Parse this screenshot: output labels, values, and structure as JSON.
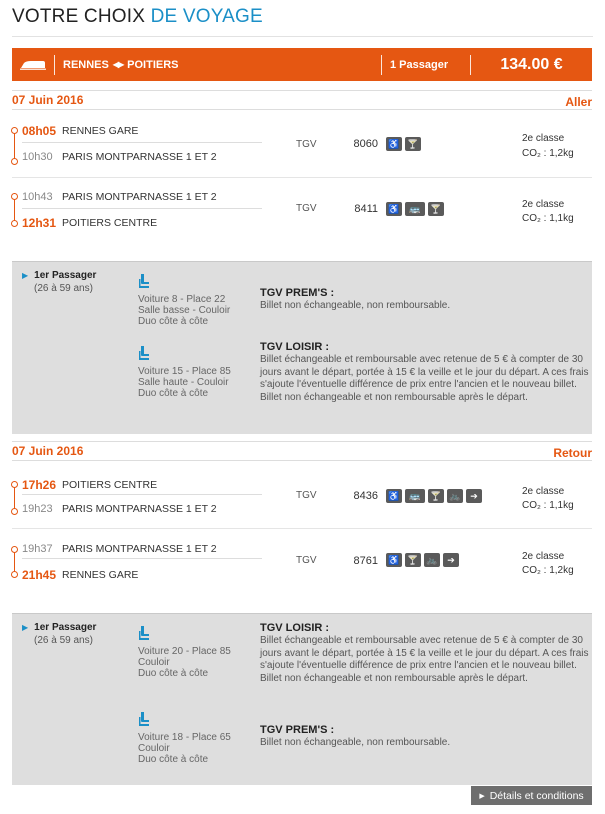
{
  "page": {
    "title_part1": "VOTRE CHOIX",
    "title_part2": "DE VOYAGE"
  },
  "summary": {
    "origin": "RENNES",
    "destination": "POITIERS",
    "passengers": "1 Passager",
    "price": "134.00 €"
  },
  "outbound": {
    "date": "07 Juin 2016",
    "direction": "Aller",
    "segments": [
      {
        "dep_time": "08h05",
        "dep_station": "RENNES GARE",
        "arr_time": "10h30",
        "arr_station": "PARIS MONTPARNASSE 1 ET 2",
        "type": "TGV",
        "number": "8060",
        "class": "2e classe",
        "co2": "CO₂ : 1,2kg",
        "icons": [
          "wheelchair-icon",
          "bar-icon"
        ]
      },
      {
        "dep_time": "10h43",
        "dep_station": "PARIS MONTPARNASSE 1 ET 2",
        "arr_time": "12h31",
        "arr_station": "POITIERS CENTRE",
        "type": "TGV",
        "number": "8411",
        "class": "2e classe",
        "co2": "CO₂ : 1,1kg",
        "icons": [
          "wheelchair-icon",
          "bus-icon",
          "bar-icon"
        ]
      }
    ],
    "passenger": {
      "label": "1er Passager",
      "age": "(26 à 59 ans)",
      "seats": [
        {
          "line1": "Voiture 8 - Place 22",
          "line2": "Salle basse - Couloir",
          "line3": "Duo côte à côte"
        },
        {
          "line1": "Voiture 15 - Place 85",
          "line2": "Salle haute - Couloir",
          "line3": "Duo côte à côte"
        }
      ],
      "tarifs": [
        {
          "name": "TGV PREM'S :",
          "desc": "Billet non échangeable, non remboursable."
        },
        {
          "name": "TGV LOISIR :",
          "desc": "Billet échangeable et remboursable avec retenue de 5 € à compter de 30 jours avant le départ, portée à 15 € la veille et le jour du départ. A ces frais s'ajoute l'éventuelle différence de prix entre l'ancien et le nouveau billet. Billet non échangeable et non remboursable après le départ."
        }
      ]
    }
  },
  "inbound": {
    "date": "07 Juin 2016",
    "direction": "Retour",
    "segments": [
      {
        "dep_time": "17h26",
        "dep_station": "POITIERS CENTRE",
        "arr_time": "19h23",
        "arr_station": "PARIS MONTPARNASSE 1 ET 2",
        "type": "TGV",
        "number": "8436",
        "class": "2e classe",
        "co2": "CO₂ : 1,1kg",
        "icons": [
          "wheelchair-icon",
          "bus-icon",
          "bar-icon",
          "bike-icon",
          "arrow-icon"
        ]
      },
      {
        "dep_time": "19h37",
        "dep_station": "PARIS MONTPARNASSE 1 ET 2",
        "arr_time": "21h45",
        "arr_station": "RENNES GARE",
        "type": "TGV",
        "number": "8761",
        "class": "2e classe",
        "co2": "CO₂ : 1,2kg",
        "icons": [
          "wheelchair-icon",
          "bar-icon",
          "bike-icon",
          "arrow-icon"
        ]
      }
    ],
    "passenger": {
      "label": "1er Passager",
      "age": "(26 à 59 ans)",
      "seats": [
        {
          "line1": "Voiture 20 - Place 85",
          "line2": "Couloir",
          "line3": "Duo côte à côte"
        },
        {
          "line1": "Voiture 18 - Place 65",
          "line2": "Couloir",
          "line3": "Duo côte à côte"
        }
      ],
      "tarifs": [
        {
          "name": "TGV LOISIR :",
          "desc": "Billet échangeable et remboursable avec retenue de 5 € à compter de 30 jours avant le départ, portée à 15 € la veille et le jour du départ. A ces frais s'ajoute l'éventuelle différence de prix entre l'ancien et le nouveau billet. Billet non échangeable et non remboursable après le départ."
        },
        {
          "name": "TGV PREM'S :",
          "desc": "Billet non échangeable, non remboursable."
        }
      ]
    }
  },
  "footer": {
    "details_label": "Détails et conditions"
  },
  "colors": {
    "accent": "#e55712",
    "title_blue": "#1b8fc7",
    "panel": "#dedede"
  }
}
